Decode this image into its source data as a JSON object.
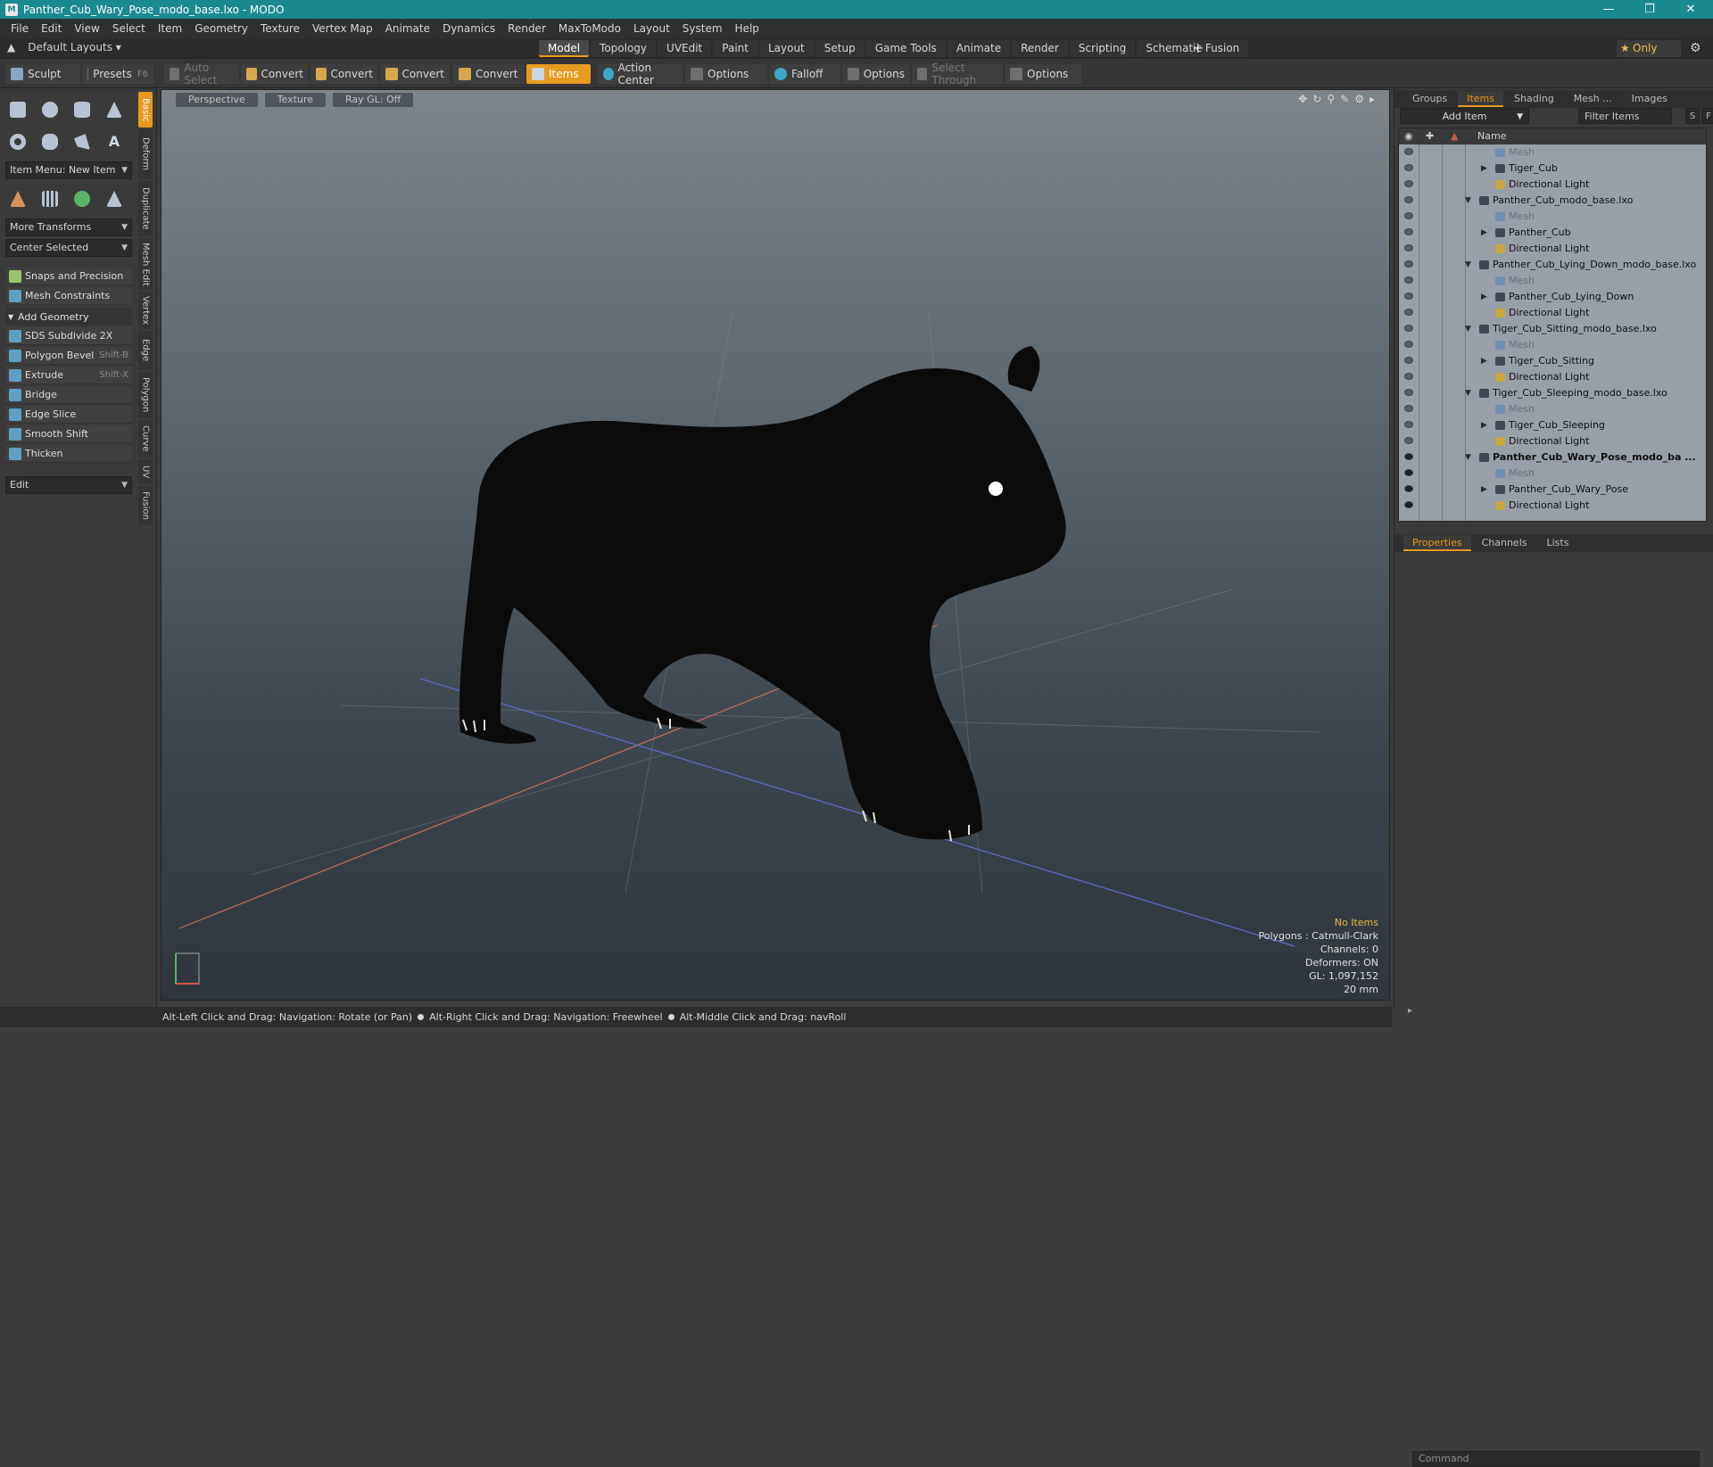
{
  "window": {
    "title": "Panther_Cub_Wary_Pose_modo_base.lxo - MODO",
    "logo": "M"
  },
  "menu": [
    "File",
    "Edit",
    "View",
    "Select",
    "Item",
    "Geometry",
    "Texture",
    "Vertex Map",
    "Animate",
    "Dynamics",
    "Render",
    "MaxToModo",
    "Layout",
    "System",
    "Help"
  ],
  "layout": {
    "default": "Default Layouts",
    "only": "Only",
    "tabs": [
      "Model",
      "Topology",
      "UVEdit",
      "Paint",
      "Layout",
      "Setup",
      "Game Tools",
      "Animate",
      "Render",
      "Scripting",
      "Schematic Fusion"
    ],
    "active_tab": "Model"
  },
  "toolbar": {
    "sculpt": "Sculpt",
    "presets": "Presets",
    "presets_key": "F6",
    "auto_select": "Auto Select",
    "convert": "Convert",
    "items": "Items",
    "action_center": "Action Center",
    "options": "Options",
    "falloff": "Falloff",
    "select_through": "Select Through"
  },
  "left": {
    "item_menu": "Item Menu: New Item",
    "more_transforms": "More Transforms",
    "center_selected": "Center Selected",
    "snaps": "Snaps and Precision",
    "mesh_constraints": "Mesh Constraints",
    "add_geometry": "Add Geometry",
    "tools": [
      {
        "label": "SDS Subdivide 2X",
        "key": ""
      },
      {
        "label": "Polygon Bevel",
        "key": "Shift-B"
      },
      {
        "label": "Extrude",
        "key": "Shift-X"
      },
      {
        "label": "Bridge",
        "key": ""
      },
      {
        "label": "Edge Slice",
        "key": ""
      },
      {
        "label": "Smooth Shift",
        "key": ""
      },
      {
        "label": "Thicken",
        "key": ""
      }
    ],
    "edit": "Edit",
    "vtabs": [
      "Basic",
      "Deform",
      "Duplicate",
      "Mesh Edit",
      "Vertex",
      "Edge",
      "Polygon",
      "Curve",
      "UV",
      "Fusion"
    ]
  },
  "viewport": {
    "perspective": "Perspective",
    "texture": "Texture",
    "raygl": "Ray GL: Off",
    "info": {
      "items": "No Items",
      "polygons": "Polygons : Catmull-Clark",
      "channels": "Channels: 0",
      "deformers": "Deformers: ON",
      "gl": "GL: 1,097,152",
      "scale": "20 mm"
    }
  },
  "right": {
    "tabs": [
      "Groups",
      "Items",
      "Shading",
      "Mesh ...",
      "Images"
    ],
    "active_tab": "Items",
    "add_item": "Add Item",
    "filter": "Filter Items",
    "s": "S",
    "f": "F",
    "name_col": "Name",
    "tree": [
      {
        "label": "Mesh",
        "depth": 2,
        "type": "mesh",
        "dim": true,
        "eye": false
      },
      {
        "label": "Tiger_Cub",
        "depth": 2,
        "type": "item",
        "expand": true,
        "eye": false
      },
      {
        "label": "Directional Light",
        "depth": 2,
        "type": "light",
        "eye": false
      },
      {
        "label": "Panther_Cub_modo_base.lxo",
        "depth": 1,
        "type": "scene",
        "open": true,
        "eye": false
      },
      {
        "label": "Mesh",
        "depth": 2,
        "type": "mesh",
        "dim": true,
        "eye": false
      },
      {
        "label": "Panther_Cub",
        "depth": 2,
        "type": "item",
        "expand": true,
        "eye": false
      },
      {
        "label": "Directional Light",
        "depth": 2,
        "type": "light",
        "eye": false
      },
      {
        "label": "Panther_Cub_Lying_Down_modo_base.lxo",
        "depth": 1,
        "type": "scene",
        "open": true,
        "eye": false
      },
      {
        "label": "Mesh",
        "depth": 2,
        "type": "mesh",
        "dim": true,
        "eye": false
      },
      {
        "label": "Panther_Cub_Lying_Down",
        "depth": 2,
        "type": "item",
        "expand": true,
        "eye": false
      },
      {
        "label": "Directional Light",
        "depth": 2,
        "type": "light",
        "eye": false
      },
      {
        "label": "Tiger_Cub_Sitting_modo_base.lxo",
        "depth": 1,
        "type": "scene",
        "open": true,
        "eye": false
      },
      {
        "label": "Mesh",
        "depth": 2,
        "type": "mesh",
        "dim": true,
        "eye": false
      },
      {
        "label": "Tiger_Cub_Sitting",
        "depth": 2,
        "type": "item",
        "expand": true,
        "eye": false
      },
      {
        "label": "Directional Light",
        "depth": 2,
        "type": "light",
        "eye": false
      },
      {
        "label": "Tiger_Cub_Sleeping_modo_base.lxo",
        "depth": 1,
        "type": "scene",
        "open": true,
        "eye": false
      },
      {
        "label": "Mesh",
        "depth": 2,
        "type": "mesh",
        "dim": true,
        "eye": false
      },
      {
        "label": "Tiger_Cub_Sleeping",
        "depth": 2,
        "type": "item",
        "expand": true,
        "eye": false
      },
      {
        "label": "Directional Light",
        "depth": 2,
        "type": "light",
        "eye": false
      },
      {
        "label": "Panther_Cub_Wary_Pose_modo_ba ...",
        "depth": 1,
        "type": "scene",
        "open": true,
        "bold": true,
        "eye": true
      },
      {
        "label": "Mesh",
        "depth": 2,
        "type": "mesh",
        "dim": true,
        "eye": true
      },
      {
        "label": "Panther_Cub_Wary_Pose",
        "depth": 2,
        "type": "item",
        "expand": true,
        "eye": true
      },
      {
        "label": "Directional Light",
        "depth": 2,
        "type": "light",
        "eye": true
      }
    ],
    "prop_tabs": [
      "Properties",
      "Channels",
      "Lists"
    ],
    "prop_active": "Properties",
    "command": "Command"
  },
  "status": [
    "Alt-Left Click and Drag: Navigation: Rotate (or Pan)",
    "Alt-Right Click and Drag: Navigation: Freewheel",
    "Alt-Middle Click and Drag: navRoll"
  ],
  "colors": {
    "accent": "#e89a1f",
    "titlebar": "#1b8a8f"
  }
}
